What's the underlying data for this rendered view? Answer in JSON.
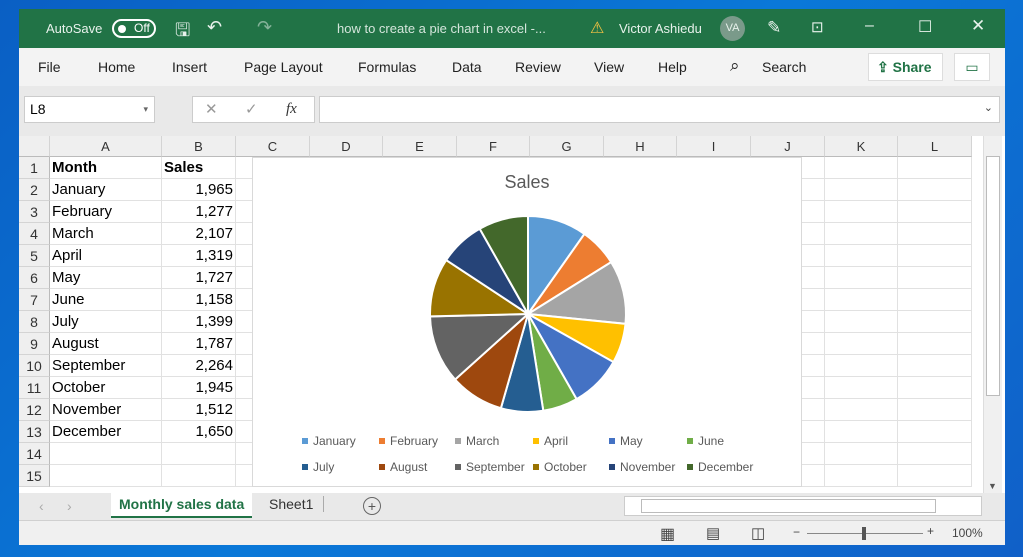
{
  "titlebar": {
    "autosave": "AutoSave",
    "toggle": "Off",
    "doc_title": "how to create a pie chart in excel  -...",
    "user": "Victor Ashiedu",
    "initials": "VA"
  },
  "ribbon": {
    "tabs": [
      "File",
      "Home",
      "Insert",
      "Page Layout",
      "Formulas",
      "Data",
      "Review",
      "View",
      "Help"
    ],
    "search": "Search",
    "share": "Share"
  },
  "formula_bar": {
    "name_box": "L8",
    "fx": "fx",
    "value": ""
  },
  "columns": [
    "A",
    "B",
    "C",
    "D",
    "E",
    "F",
    "G",
    "H",
    "I",
    "J",
    "K",
    "L"
  ],
  "rows": [
    "1",
    "2",
    "3",
    "4",
    "5",
    "6",
    "7",
    "8",
    "9",
    "10",
    "11",
    "12",
    "13",
    "14",
    "15"
  ],
  "table": {
    "headers": [
      "Month",
      "Sales"
    ],
    "data": [
      [
        "January",
        "1,965"
      ],
      [
        "February",
        "1,277"
      ],
      [
        "March",
        "2,107"
      ],
      [
        "April",
        "1,319"
      ],
      [
        "May",
        "1,727"
      ],
      [
        "June",
        "1,158"
      ],
      [
        "July",
        "1,399"
      ],
      [
        "August",
        "1,787"
      ],
      [
        "September",
        "2,264"
      ],
      [
        "October",
        "1,945"
      ],
      [
        "November",
        "1,512"
      ],
      [
        "December",
        "1,650"
      ]
    ]
  },
  "chart_data": {
    "type": "pie",
    "title": "Sales",
    "categories": [
      "January",
      "February",
      "March",
      "April",
      "May",
      "June",
      "July",
      "August",
      "September",
      "October",
      "November",
      "December"
    ],
    "values": [
      1965,
      1277,
      2107,
      1319,
      1727,
      1158,
      1399,
      1787,
      2264,
      1945,
      1512,
      1650
    ],
    "colors": [
      "#5b9bd5",
      "#ed7d31",
      "#a5a5a5",
      "#ffc000",
      "#4472c4",
      "#70ad47",
      "#255e91",
      "#9e480e",
      "#636363",
      "#997300",
      "#264478",
      "#43682b"
    ],
    "legend": "bottom"
  },
  "sheets": {
    "active": "Monthly sales data",
    "other": "Sheet1"
  },
  "status": {
    "zoom": "100%"
  }
}
